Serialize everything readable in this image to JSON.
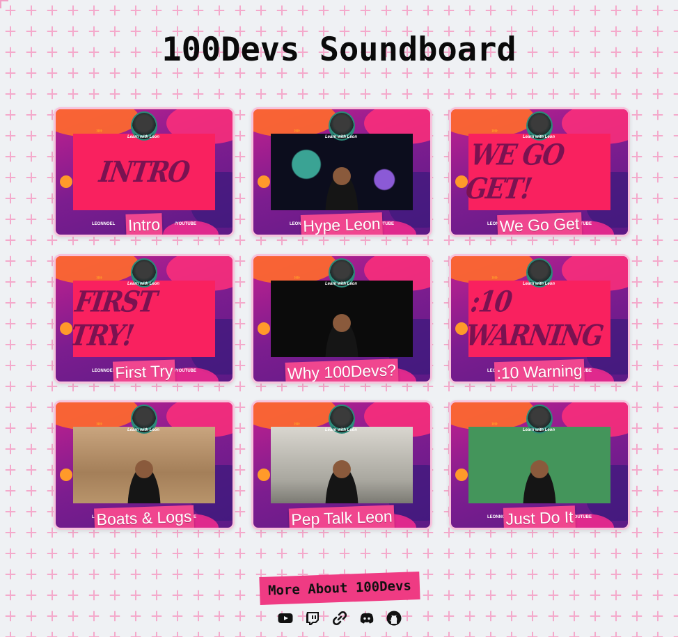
{
  "page": {
    "title": "100Devs Soundboard"
  },
  "cards": [
    {
      "label": "Intro",
      "screen_word": "INTRO",
      "screen": "word"
    },
    {
      "label": "Hype Leon",
      "screen_word": "",
      "screen": "space"
    },
    {
      "label": "We Go Get",
      "screen_word": "WE GO GET!",
      "screen": "word"
    },
    {
      "label": "First Try",
      "screen_word": "FIRST TRY!",
      "screen": "word"
    },
    {
      "label": "Why 100Devs?",
      "screen_word": "",
      "screen": "dark"
    },
    {
      "label": ":10 Warning",
      "screen_word": ":10 WARNING",
      "screen": "word"
    },
    {
      "label": "Boats & Logs",
      "screen_word": "",
      "screen": "sand"
    },
    {
      "label": "Pep Talk Leon",
      "screen_word": "",
      "screen": "office"
    },
    {
      "label": "Just Do It",
      "screen_word": "",
      "screen": "green"
    }
  ],
  "card_overlay": {
    "logo_text": "Learn with Leon",
    "left_handle": "LEONNOEL",
    "right_handle": "/YOUTUBE"
  },
  "footer": {
    "more_label": "More About 100Devs"
  },
  "social_icons": [
    "youtube-icon",
    "twitch-icon",
    "link-icon",
    "discord-icon",
    "github-icon"
  ],
  "colors": {
    "accent": "#f0468f",
    "background": "#eff1f4",
    "card_border": "#f7c2dc"
  }
}
